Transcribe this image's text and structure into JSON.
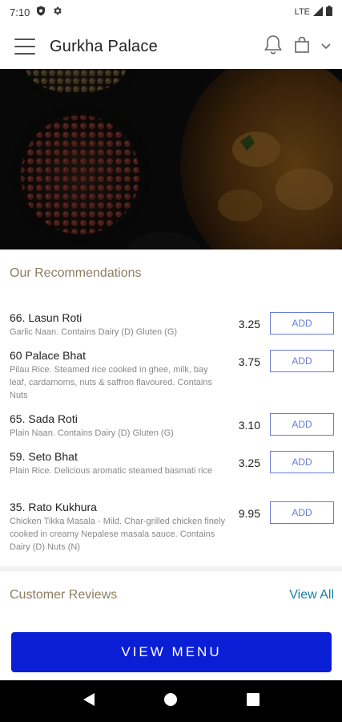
{
  "status_bar": {
    "time": "7:10",
    "network": "LTE"
  },
  "app": {
    "title": "Gurkha Palace"
  },
  "recommendations": {
    "title": "Our Recommendations",
    "items": [
      {
        "name": "66. Lasun Roti",
        "desc": "Garlic Naan. Contains  Dairy (D)  Gluten (G)",
        "price": "3.25",
        "button": "ADD"
      },
      {
        "name": "60 Palace Bhat",
        "desc": "Pilau Rice. Steamed rice cooked in ghee, milk, bay leaf, cardamoms, nuts & saffron flavoured. Contains  Nuts",
        "price": "3.75",
        "button": "ADD"
      },
      {
        "name": "65. Sada Roti",
        "desc": "Plain Naan. Contains  Dairy (D)  Gluten (G)",
        "price": "3.10",
        "button": "ADD"
      },
      {
        "name": "59. Seto Bhat",
        "desc": "Plain Rice. Delicious aromatic steamed basmati rice",
        "price": "3.25",
        "button": "ADD"
      },
      {
        "name": "35. Rato Kukhura",
        "desc": "Chicken Tikka Masala - Mild. Char-grilled chicken finely cooked in creamy Nepalese masala sauce.   Contains  Dairy (D)  Nuts (N)",
        "price": "9.95",
        "button": "ADD"
      }
    ]
  },
  "reviews": {
    "title": "Customer Reviews",
    "view_all": "View All"
  },
  "cta": {
    "label": "VIEW MENU"
  },
  "colors": {
    "accent": "#0a1ed6",
    "section_title": "#8b7e62",
    "add_button": "#6a7bd6",
    "link": "#1a7fa8"
  }
}
